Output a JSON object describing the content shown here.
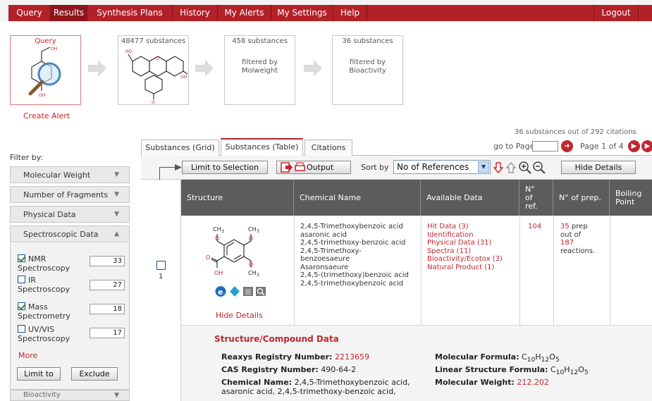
{
  "nav": {
    "items": [
      "Query",
      "Results",
      "Synthesis Plans",
      "History",
      "My Alerts",
      "My Settings",
      "Help"
    ],
    "active": "Results",
    "logout": "Logout"
  },
  "workflow": {
    "query_title": "Query",
    "step1_title": "48477 substances",
    "step2_title": "458 substances",
    "step2_sub": "filtered by Molweight",
    "step3_title": "36 substances",
    "step3_sub": "filtered by Bioactivity",
    "create_alert": "Create Alert"
  },
  "status_text": "36 substances out of 292 citations",
  "filter": {
    "label": "Filter by:",
    "panels": [
      "Molecular Weight",
      "Number of Fragments",
      "Physical Data",
      "Spectroscopic Data"
    ],
    "spectroscopy": [
      {
        "label1": "NMR",
        "label2": "Spectroscopy",
        "checked": true,
        "count": "33"
      },
      {
        "label1": "IR",
        "label2": "Spectroscopy",
        "checked": false,
        "count": "27"
      },
      {
        "label1": "Mass",
        "label2": "Spectrometry",
        "checked": true,
        "count": "18"
      },
      {
        "label1": "UV/VIS",
        "label2": "Spectroscopy",
        "checked": false,
        "count": "17"
      }
    ],
    "more": "More",
    "limit_to": "Limit to",
    "exclude": "Exclude",
    "bioactivity_panel": "Bioactivity"
  },
  "tabs": [
    "Substances (Grid)",
    "Substances (Table)",
    "Citations"
  ],
  "pager": {
    "go_to_page": "go to Page",
    "page_info": "Page 1 of 4"
  },
  "toolbar": {
    "limit_to_selection": "Limit to Selection",
    "output": "Output",
    "sort_by": "Sort by",
    "sort_value": "No of References",
    "hide_details": "Hide Details"
  },
  "table": {
    "headers": [
      "Structure",
      "Chemical Name",
      "Available Data",
      "N° of ref.",
      "N° of prep.",
      "Boiling Point"
    ],
    "row": {
      "index": "1",
      "names": [
        "2,4,5-Trimethoxybenzoic acid",
        "asaronic acid",
        "2,4,5-trimethoxy-benzoic acid",
        "2,4,5-Trimethoxy-",
        "benzoesaeure",
        "Asaronsaeure",
        "2,4,5-(trimethoxy)benzoic acid",
        "2,4,5-trimethoxybenzoic acid"
      ],
      "available_data": [
        "Hit Data (3)",
        "Identification",
        "Physical Data (31)",
        "Spectra (11)",
        "Bioactivity/Ecotox (3)",
        "Natural Product (1)"
      ],
      "refs": "104",
      "prep_count": "35",
      "prep_text1": "prep",
      "prep_text2": "out of",
      "prep_total": "187",
      "prep_text3": "reactions.",
      "hide_details": "Hide Details"
    }
  },
  "details": {
    "heading": "Structure/Compound Data",
    "reaxys_label": "Reaxys Registry Number:",
    "reaxys_value": "2213659",
    "cas_label": "CAS Registry Number:",
    "cas_value": "490-64-2",
    "chem_name_label": "Chemical Name:",
    "chem_name_value1": "2,4,5-Trimethoxybenzoic acid,",
    "chem_name_value2": "asaronic acid, 2,4,5-trimethoxy-benzoic acid,",
    "mf_label": "Molecular Formula:",
    "lsf_label": "Linear Structure Formula:",
    "mw_label": "Molecular Weight:",
    "mw_value": "212.202",
    "formula": {
      "c": "C",
      "c_sub": "10",
      "h": "H",
      "h_sub": "12",
      "o": "O",
      "o_sub": "5"
    }
  },
  "colors": {
    "brand_red": "#b32128",
    "link_red": "#c0272d",
    "header_gray": "#5c5c5c"
  }
}
